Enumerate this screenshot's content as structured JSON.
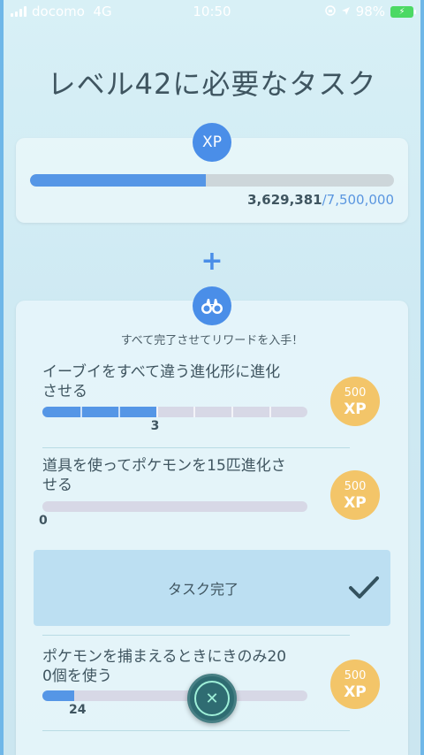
{
  "status_bar": {
    "carrier": "docomo",
    "network": "4G",
    "time": "10:50",
    "battery": "98%"
  },
  "page_title": "レベル42に必要なタスク",
  "xp": {
    "badge": "XP",
    "current": "3,629,381",
    "separator": "/",
    "max": "7,500,000",
    "progress_fraction": 0.484
  },
  "plus_symbol": "+",
  "rewards_caption": "すべて完了させてリワードを入手！",
  "tasks": [
    {
      "label_line1": "イーブイをすべて違う進化形に進化",
      "label_line2": "させる",
      "count": "3",
      "progress_fraction": 0.4286,
      "segments": 7,
      "reward_amount": "500",
      "reward_unit": "XP"
    },
    {
      "label_line1": "道具を使ってポケモンを15匹進化さ",
      "label_line2": "せる",
      "count": "0",
      "progress_fraction": 0,
      "reward_amount": "500",
      "reward_unit": "XP"
    },
    {
      "label": "タスク完了"
    },
    {
      "label_line1": "ポケモンを捕まえるときにきのみ20",
      "label_line2": "0個を使う",
      "count": "24",
      "progress_fraction": 0.12,
      "reward_amount": "500",
      "reward_unit": "XP"
    }
  ],
  "icons": {
    "xp_badge": "xp-icon",
    "binoculars": "binoculars-icon",
    "check": "check-icon",
    "close": "close-icon"
  },
  "colors": {
    "accent_blue": "#4a8ee8",
    "reward_gold": "#f3c569",
    "complete_bg": "#bcdff2"
  }
}
